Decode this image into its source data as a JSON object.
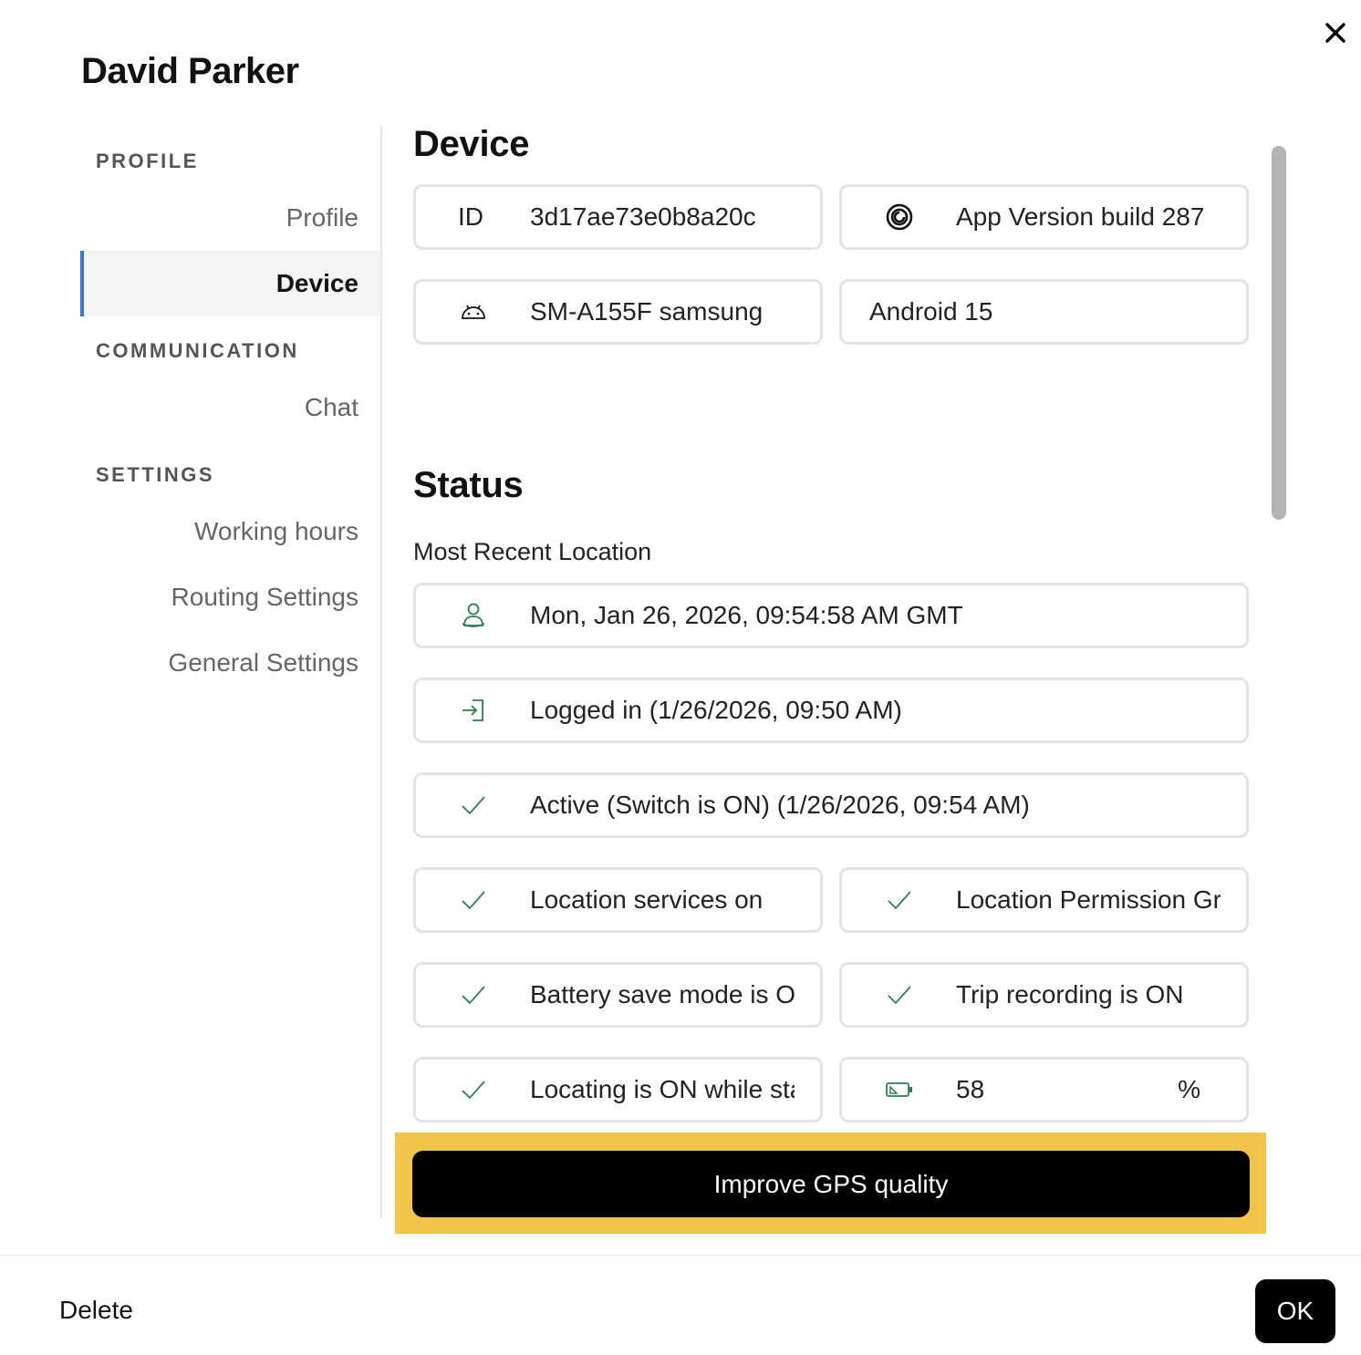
{
  "dialog": {
    "title": "David Parker"
  },
  "sidebar": {
    "sections": [
      {
        "label": "PROFILE",
        "items": [
          "Profile",
          "Device"
        ]
      },
      {
        "label": "COMMUNICATION",
        "items": [
          "Chat"
        ]
      },
      {
        "label": "SETTINGS",
        "items": [
          "Working hours",
          "Routing Settings",
          "General Settings"
        ]
      }
    ],
    "active": "Device"
  },
  "device": {
    "heading": "Device",
    "id_label": "ID",
    "id_value": "3d17ae73e0b8a20c",
    "app_version": "App Version build 287",
    "model": "SM-A155F samsung",
    "os": "Android 15"
  },
  "status": {
    "heading": "Status",
    "subheading": "Most Recent Location",
    "last_location": "Mon, Jan 26, 2026, 09:54:58 AM GMT",
    "logged_in": "Logged in (1/26/2026, 09:50 AM)",
    "active": "Active (Switch is ON) (1/26/2026, 09:54 AM)",
    "location_services": "Location services on",
    "location_permission": "Location Permission Granted",
    "battery_save": "Battery save mode is OFF",
    "trip_recording": "Trip recording is ON",
    "locating_still": "Locating is ON while standing still",
    "battery_value": "58",
    "battery_unit": "%"
  },
  "actions": {
    "improve_gps": "Improve GPS quality",
    "delete": "Delete",
    "ok": "OK"
  },
  "colors": {
    "accent": "#3b73d9",
    "highlight": "#f2c54a",
    "check": "#2e7d4f"
  }
}
